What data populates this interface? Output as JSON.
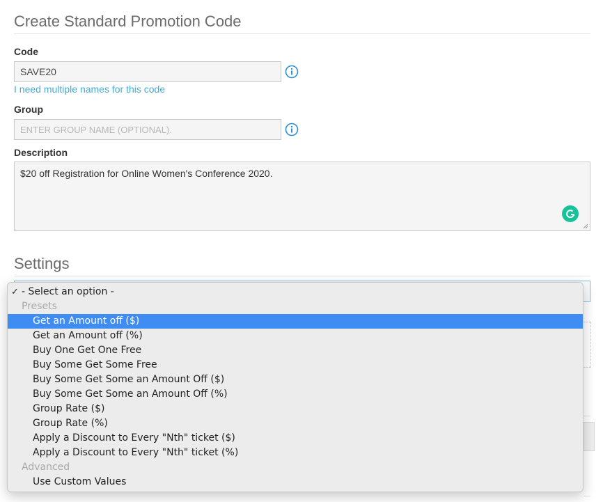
{
  "page": {
    "title": "Create Standard Promotion Code"
  },
  "code": {
    "label": "Code",
    "value": "SAVE20",
    "multiple_names_link": "I need multiple names for this code"
  },
  "group": {
    "label": "Group",
    "placeholder": "ENTER GROUP NAME (OPTIONAL)."
  },
  "description": {
    "label": "Description",
    "value": "$20 off Registration for Online Women's Conference 2020."
  },
  "settings": {
    "title": "Settings",
    "dropdown": {
      "selected": "- Select an option -",
      "check_mark": "✓",
      "groups": [
        {
          "label": "Presets",
          "options": [
            "Get an Amount off ($)",
            "Get an Amount off (%)",
            "Buy One Get One Free",
            "Buy Some Get Some Free",
            "Buy Some Get Some an Amount Off ($)",
            "Buy Some Get Some an Amount Off (%)",
            "Group Rate ($)",
            "Group Rate (%)",
            "Apply a Discount to Every \"Nth\" ticket ($)",
            "Apply a Discount to Every \"Nth\" ticket (%)"
          ]
        },
        {
          "label": "Advanced",
          "options": [
            "Use Custom Values"
          ]
        }
      ],
      "highlighted": "Get an Amount off ($)"
    }
  },
  "colors": {
    "link": "#49a9d0",
    "highlight": "#3f8cf3",
    "grammarly": "#15c39a"
  }
}
